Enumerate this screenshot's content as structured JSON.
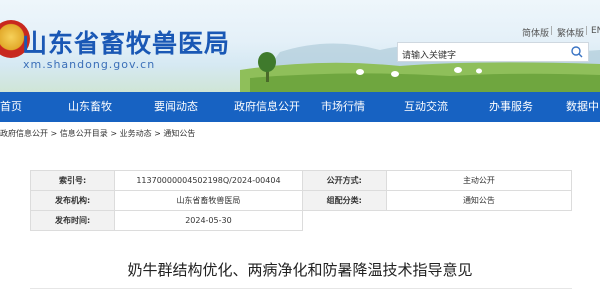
{
  "header": {
    "site_title": "山东省畜牧兽医局",
    "site_domain": "xm.shandong.gov.cn",
    "lang": {
      "simplified": "简体版",
      "traditional": "繁体版",
      "en": "EN"
    },
    "search": {
      "placeholder": "请输入关键字"
    }
  },
  "nav": {
    "items": [
      {
        "label": "首页"
      },
      {
        "label": "山东畜牧"
      },
      {
        "label": "要闻动态"
      },
      {
        "label": "政府信息公开"
      },
      {
        "label": "市场行情"
      },
      {
        "label": "互动交流"
      },
      {
        "label": "办事服务"
      },
      {
        "label": "数据中"
      }
    ]
  },
  "breadcrumb": {
    "items": [
      "政府信息公开",
      "信息公开目录",
      "业务动态",
      "通知公告"
    ],
    "separator": " > "
  },
  "meta": {
    "index_label": "索引号:",
    "index_value": "11370000004502198Q/2024-00404",
    "disclosure_label": "公开方式:",
    "disclosure_value": "主动公开",
    "issuer_label": "发布机构:",
    "issuer_value": "山东省畜牧兽医局",
    "category_label": "组配分类:",
    "category_value": "通知公告",
    "date_label": "发布时间:",
    "date_value": "2024-05-30"
  },
  "document": {
    "title": "奶牛群结构优化、两病净化和防暑降温技术指导意见"
  },
  "colors": {
    "nav_bg": "#1762c2",
    "title_blue": "#1a58b5"
  }
}
